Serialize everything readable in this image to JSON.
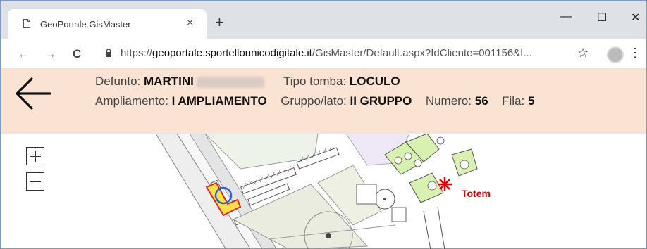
{
  "browser": {
    "tab_title": "GeoPortale GisMaster",
    "tab_close": "×",
    "new_tab": "+",
    "url_prefix": "https://",
    "url_host": "geoportale.sportellounicodigitale.it",
    "url_path": "/GisMaster/Default.aspx?IdCliente=001156&I...",
    "controls": {
      "minimize": "—",
      "maximize": "☐",
      "close": "✕",
      "star": "☆",
      "menu": "⋮"
    },
    "nav": {
      "back": "←",
      "forward": "→",
      "reload": "C"
    }
  },
  "info": {
    "defunto_label": "Defunto:",
    "defunto_value": "MARTINI",
    "tipo_label": "Tipo tomba:",
    "tipo_value": "LOCULO",
    "ampliamento_label": "Ampliamento:",
    "ampliamento_value": "I AMPLIAMENTO",
    "gruppo_label": "Gruppo/lato:",
    "gruppo_value": "II GRUPPO",
    "numero_label": "Numero:",
    "numero_value": "56",
    "fila_label": "Fila:",
    "fila_value": "5"
  },
  "map": {
    "totem_label": "Totem"
  },
  "colors": {
    "infobar_bg": "#fbe3d4",
    "totem_red": "#dd0000",
    "selection_yellow": "#ffe24a",
    "selection_blue": "#2a62d8",
    "green_area": "#d8f0b0"
  }
}
